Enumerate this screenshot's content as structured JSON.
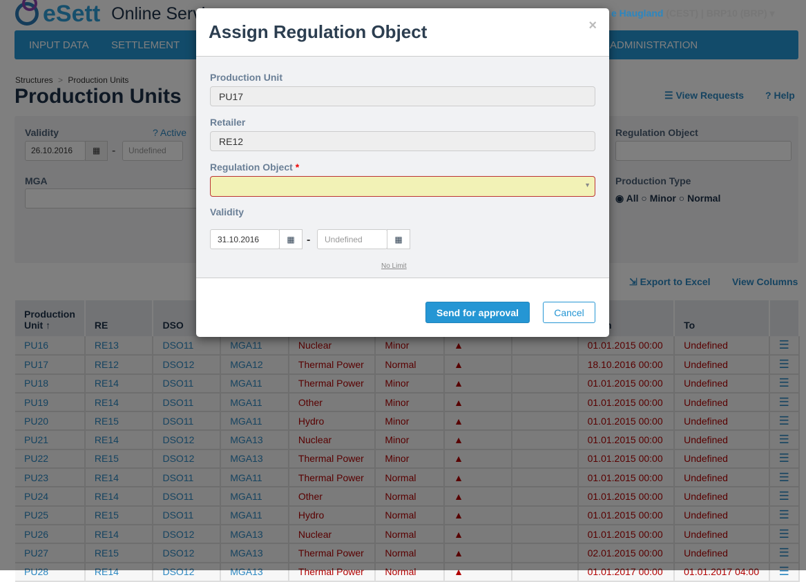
{
  "header": {
    "brand": "eSett",
    "service": "Online Service",
    "user_name": "e Haugland",
    "user_tz": "(CEST)",
    "separator": "|",
    "role": "BRP10 (BRP)"
  },
  "nav": [
    "INPUT DATA",
    "SETTLEMENT",
    "ADMINISTRATION"
  ],
  "breadcrumb": {
    "parent": "Structures",
    "sep": ">",
    "current": "Production Units"
  },
  "page_title": "Production Units",
  "actions": {
    "view_requests": "View Requests",
    "help": "Help",
    "export": "Export to Excel",
    "view_columns": "View Columns"
  },
  "filters": {
    "validity_label": "Validity",
    "active_label": "Active",
    "validity_from": "26.10.2016",
    "validity_to_placeholder": "Undefined",
    "dash": "-",
    "mga_label": "MGA",
    "regobj_label": "Regulation Object",
    "prodtype_label": "Production Type",
    "prodtype_options": [
      "All",
      "Minor",
      "Normal"
    ],
    "prodtype_selected": "All"
  },
  "table": {
    "headers": [
      "Production Unit",
      "RE",
      "DSO",
      "",
      "",
      "",
      "",
      "",
      "From",
      "To",
      ""
    ],
    "rows": [
      [
        "PU16",
        "RE13",
        "DSO11",
        "MGA11",
        "Nuclear",
        "Minor",
        "01.01.2015 00:00",
        "Undefined"
      ],
      [
        "PU17",
        "RE12",
        "DSO12",
        "MGA12",
        "Thermal Power",
        "Normal",
        "18.10.2016 00:00",
        "Undefined"
      ],
      [
        "PU18",
        "RE14",
        "DSO11",
        "MGA11",
        "Thermal Power",
        "Minor",
        "01.01.2015 00:00",
        "Undefined"
      ],
      [
        "PU19",
        "RE14",
        "DSO11",
        "MGA11",
        "Other",
        "Minor",
        "01.01.2015 00:00",
        "Undefined"
      ],
      [
        "PU20",
        "RE15",
        "DSO11",
        "MGA11",
        "Hydro",
        "Minor",
        "01.01.2015 00:00",
        "Undefined"
      ],
      [
        "PU21",
        "RE14",
        "DSO12",
        "MGA13",
        "Nuclear",
        "Minor",
        "01.01.2015 00:00",
        "Undefined"
      ],
      [
        "PU22",
        "RE15",
        "DSO12",
        "MGA13",
        "Thermal Power",
        "Minor",
        "01.01.2015 00:00",
        "Undefined"
      ],
      [
        "PU23",
        "RE14",
        "DSO11",
        "MGA11",
        "Thermal Power",
        "Normal",
        "01.01.2015 00:00",
        "Undefined"
      ],
      [
        "PU24",
        "RE14",
        "DSO11",
        "MGA11",
        "Other",
        "Normal",
        "01.01.2015 00:00",
        "Undefined"
      ],
      [
        "PU25",
        "RE15",
        "DSO11",
        "MGA11",
        "Hydro",
        "Normal",
        "01.01.2015 00:00",
        "Undefined"
      ],
      [
        "PU26",
        "RE14",
        "DSO12",
        "MGA13",
        "Nuclear",
        "Normal",
        "01.01.2015 00:00",
        "Undefined"
      ],
      [
        "PU27",
        "RE15",
        "DSO12",
        "MGA13",
        "Thermal Power",
        "Normal",
        "02.01.2015 00:00",
        "Undefined"
      ],
      [
        "PU28",
        "RE14",
        "DSO12",
        "MGA13",
        "Thermal Power",
        "Normal",
        "01.01.2017 00:00",
        "01.01.2017 04:00"
      ]
    ]
  },
  "modal": {
    "title": "Assign Regulation Object",
    "close": "×",
    "pu_label": "Production Unit",
    "pu_value": "PU17",
    "retailer_label": "Retailer",
    "retailer_value": "RE12",
    "regobj_label": "Regulation Object",
    "required": "*",
    "regobj_value": "",
    "validity_label": "Validity",
    "from": "31.10.2016",
    "to_placeholder": "Undefined",
    "dash": "-",
    "no_limit": "No Limit",
    "send": "Send for approval",
    "cancel": "Cancel"
  },
  "colors": {
    "primary": "#2596d4",
    "danger": "#b10000",
    "invalid_bg": "#f2f2b6"
  }
}
